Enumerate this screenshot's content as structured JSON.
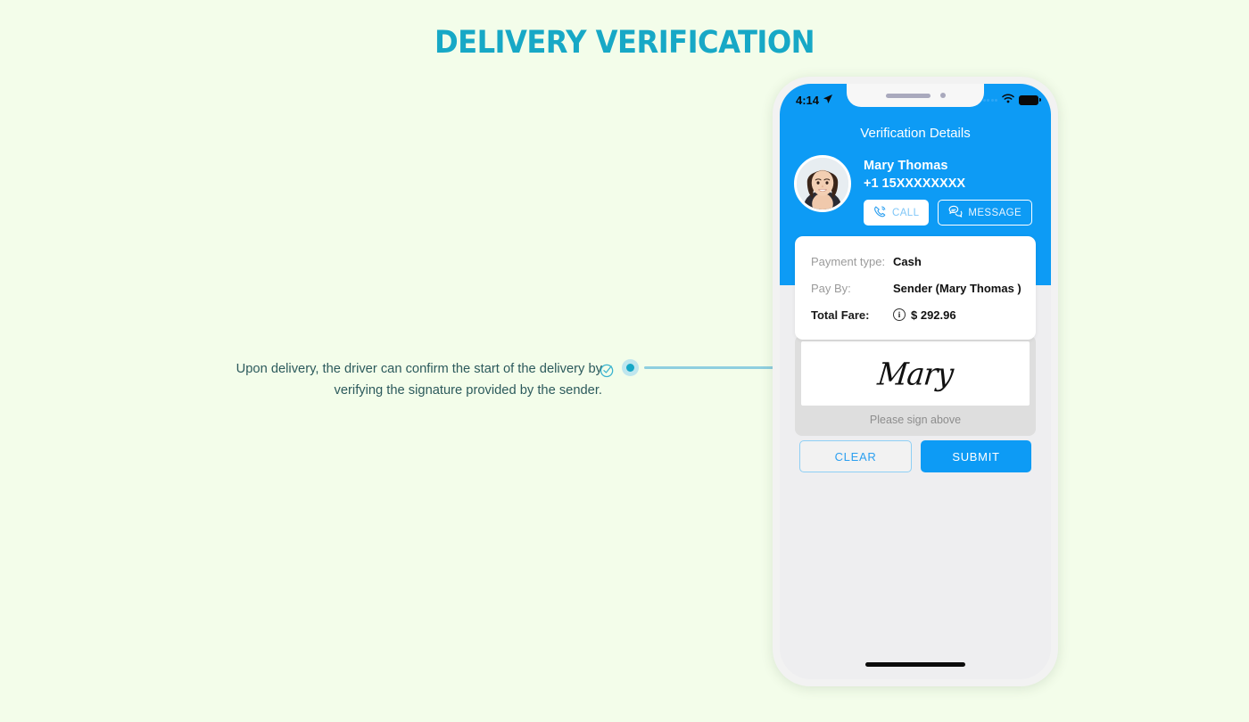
{
  "page": {
    "title": "DELIVERY VERIFICATION",
    "background_color": "#f3fdea",
    "title_color": "#17a8c6"
  },
  "annotation": {
    "text": "Upon delivery, the driver can confirm the start of the delivery by verifying the signature provided by the sender.",
    "icons": {
      "check": "check-circle-icon",
      "dot": "connector-dot",
      "line": "connector-line"
    },
    "color": "#2c5a5c"
  },
  "phone": {
    "status_bar": {
      "time": "4:14",
      "location_icon": "location-arrow-icon",
      "signal_icon": "signal-dots-icon",
      "wifi_icon": "wifi-icon",
      "battery_icon": "battery-full-icon"
    },
    "screen_title": "Verification Details",
    "accent_color": "#0d9bf5",
    "contact": {
      "avatar": "user-photo-avatar",
      "name": "Mary Thomas",
      "phone": "+1 15XXXXXXXX",
      "actions": [
        {
          "label": "CALL",
          "icon": "phone-icon"
        },
        {
          "label": "MESSAGE",
          "icon": "chat-bubbles-icon"
        }
      ]
    },
    "payment": {
      "rows": [
        {
          "label": "Payment type:",
          "value": "Cash",
          "bold_label": false,
          "has_info_icon": false
        },
        {
          "label": "Pay By:",
          "value": "Sender (Mary Thomas )",
          "bold_label": false,
          "has_info_icon": false
        },
        {
          "label": "Total Fare:",
          "value": "$ 292.96",
          "bold_label": true,
          "has_info_icon": true
        }
      ],
      "info_icon_glyph": "i"
    },
    "signature": {
      "value": "Mary",
      "hint": "Please sign above"
    },
    "buttons": {
      "clear": "CLEAR",
      "submit": "SUBMIT"
    },
    "home_indicator": "home-indicator"
  }
}
